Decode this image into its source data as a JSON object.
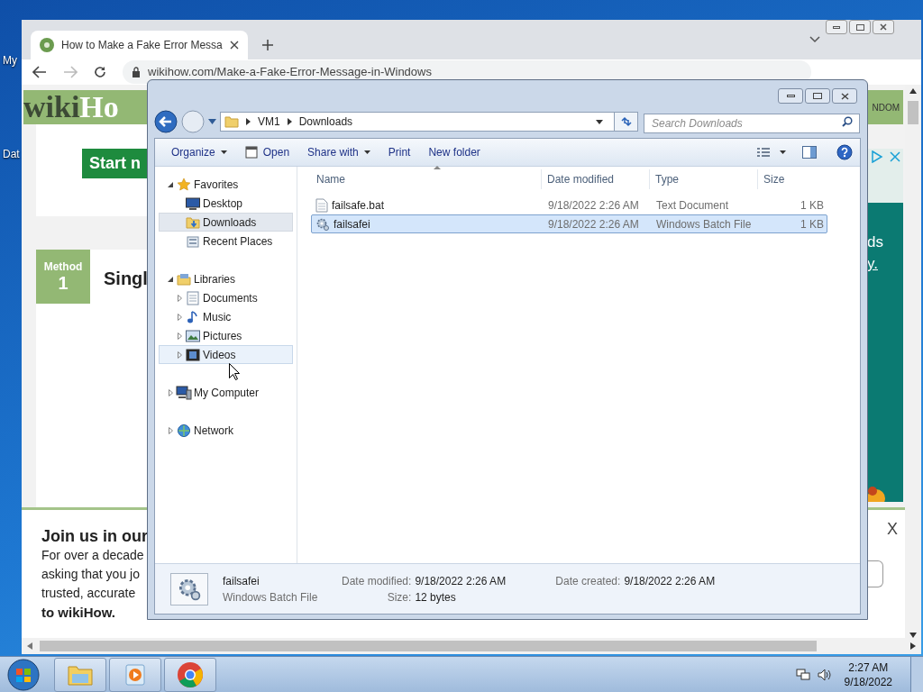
{
  "desktop": {
    "icons": [
      {
        "label": "My"
      },
      {
        "label": "Dat"
      }
    ]
  },
  "browser": {
    "tab": {
      "title": "How to Make a Fake Error Messa"
    },
    "url": "wikihow.com/Make-a-Fake-Error-Message-in-Windows",
    "page": {
      "logo": {
        "first": "wiki",
        "second": "Ho"
      },
      "nav_right": "NDOM",
      "start_button": "Start n",
      "method": {
        "label": "Method",
        "number": "1"
      },
      "heading": "Singl",
      "ad": {
        "lines": [
          "ds",
          "y."
        ]
      },
      "banner": {
        "title": "Join us in our",
        "lines": [
          "For over a decade",
          "asking that you jo",
          "trusted, accurate"
        ],
        "closing": "to wikiHow.",
        "close": "X"
      }
    }
  },
  "explorer": {
    "breadcrumb": [
      "VM1",
      "Downloads"
    ],
    "search": {
      "placeholder": "Search Downloads"
    },
    "toolbar": [
      {
        "label": "Organize",
        "kind": "menu"
      },
      {
        "label": "Open",
        "kind": "icon"
      },
      {
        "label": "Share with",
        "kind": "menu"
      },
      {
        "label": "Print",
        "kind": "plain"
      },
      {
        "label": "New folder",
        "kind": "plain"
      }
    ],
    "nav": [
      {
        "label": "Favorites",
        "kind": "star",
        "expanded": true,
        "selected": false,
        "hovered": false,
        "children": [
          {
            "label": "Desktop",
            "kind": "desktop",
            "selected": false,
            "hovered": false
          },
          {
            "label": "Downloads",
            "kind": "downloads",
            "selected": true,
            "hovered": false
          },
          {
            "label": "Recent Places",
            "kind": "recent",
            "selected": false,
            "hovered": false
          }
        ]
      },
      {
        "label": "Libraries",
        "kind": "library",
        "expanded": true,
        "selected": false,
        "hovered": false,
        "children": [
          {
            "label": "Documents",
            "kind": "document",
            "expanded": false,
            "selected": false,
            "hovered": false
          },
          {
            "label": "Music",
            "kind": "music",
            "expanded": false,
            "selected": false,
            "hovered": false
          },
          {
            "label": "Pictures",
            "kind": "picture",
            "expanded": false,
            "selected": false,
            "hovered": false
          },
          {
            "label": "Videos",
            "kind": "video",
            "expanded": false,
            "selected": false,
            "hovered": true
          }
        ]
      },
      {
        "label": "My Computer",
        "kind": "computer",
        "expanded": false,
        "selected": false,
        "hovered": false
      },
      {
        "label": "Network",
        "kind": "network",
        "expanded": false,
        "selected": false,
        "hovered": false
      }
    ],
    "columns": [
      "Name",
      "Date modified",
      "Type",
      "Size"
    ],
    "files": [
      {
        "name": "failsafe.bat",
        "kind": "text",
        "date": "9/18/2022 2:26 AM",
        "type": "Text Document",
        "size": "1 KB",
        "selected": false
      },
      {
        "name": "failsafei",
        "kind": "batch",
        "date": "9/18/2022 2:26 AM",
        "type": "Windows Batch File",
        "size": "1 KB",
        "selected": true
      }
    ],
    "details": {
      "name": "failsafei",
      "type": "Windows Batch File",
      "fields": [
        {
          "label": "Date modified:",
          "value": "9/18/2022 2:26 AM"
        },
        {
          "label": "Date created:",
          "value": "9/18/2022 2:26 AM"
        },
        {
          "label": "Size:",
          "value": "12 bytes"
        }
      ]
    }
  },
  "taskbar": {
    "apps": [
      {
        "kind": "explorer"
      },
      {
        "kind": "media"
      },
      {
        "kind": "chrome"
      }
    ],
    "time": "2:27 AM",
    "date": "9/18/2022"
  }
}
